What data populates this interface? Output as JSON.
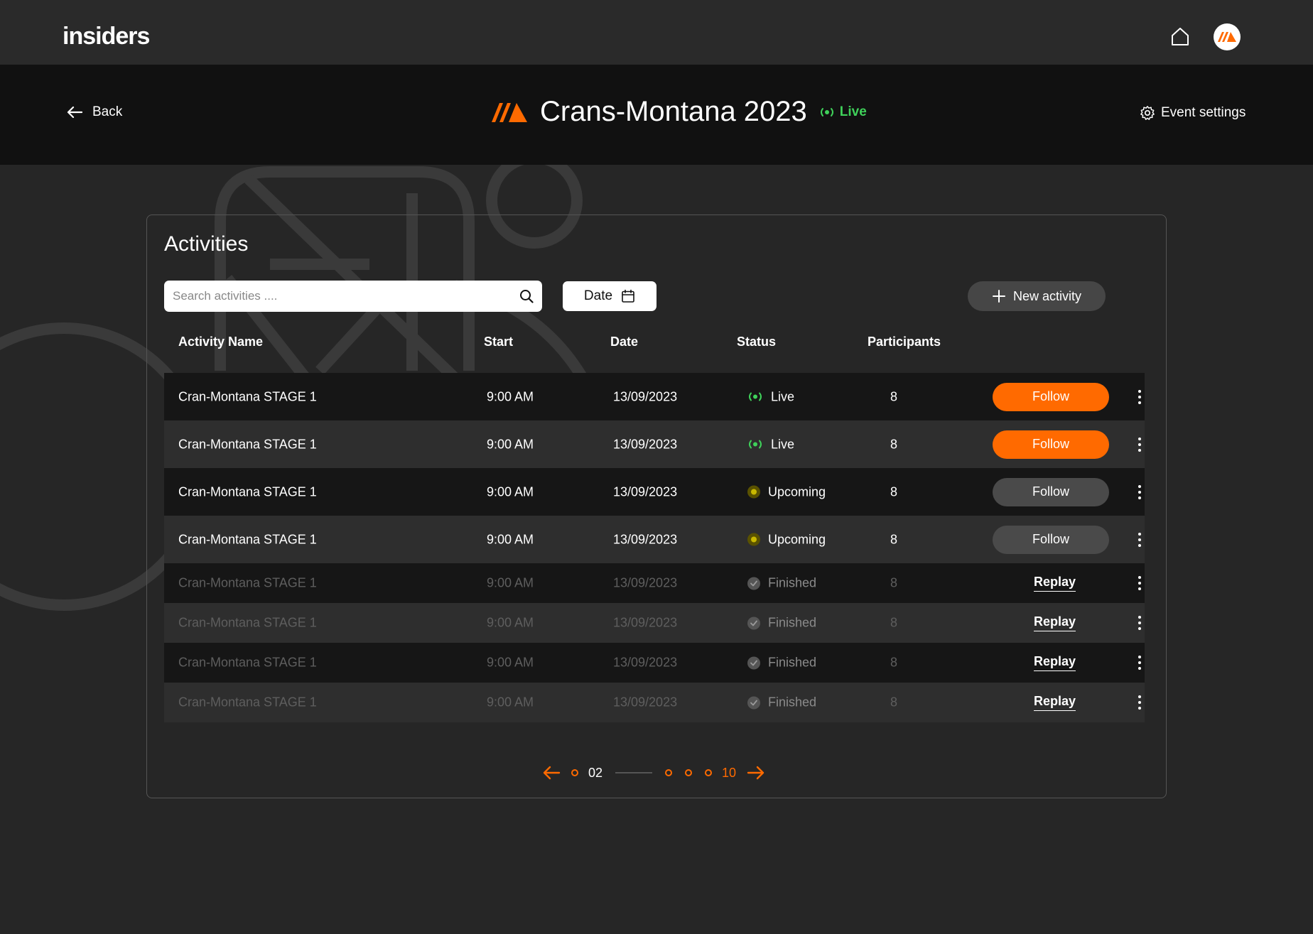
{
  "topbar": {
    "logo_text": "insiders",
    "home_icon": "home-icon",
    "avatar_icon": "brand-stripes-icon"
  },
  "event": {
    "back_label": "Back",
    "title": "Crans-Montana 2023",
    "live_label": "Live",
    "settings_label": "Event settings"
  },
  "activities": {
    "title": "Activities",
    "search_placeholder": "Search activities ....",
    "date_label": "Date",
    "new_activity_label": "New activity",
    "columns": [
      "Activity Name",
      "Start",
      "Date",
      "Status",
      "Participants"
    ],
    "rows": [
      {
        "name": "Cran-Montana STAGE 1",
        "start": "9:00 AM",
        "date": "13/09/2023",
        "status": "Live",
        "participants": "8",
        "action": "Follow"
      },
      {
        "name": "Cran-Montana STAGE 1",
        "start": "9:00 AM",
        "date": "13/09/2023",
        "status": "Live",
        "participants": "8",
        "action": "Follow"
      },
      {
        "name": "Cran-Montana STAGE 1",
        "start": "9:00 AM",
        "date": "13/09/2023",
        "status": "Upcoming",
        "participants": "8",
        "action": "Follow"
      },
      {
        "name": "Cran-Montana STAGE 1",
        "start": "9:00 AM",
        "date": "13/09/2023",
        "status": "Upcoming",
        "participants": "8",
        "action": "Follow"
      },
      {
        "name": "Cran-Montana STAGE 1",
        "start": "9:00 AM",
        "date": "13/09/2023",
        "status": "Finished",
        "participants": "8",
        "action": "Replay"
      },
      {
        "name": "Cran-Montana STAGE 1",
        "start": "9:00 AM",
        "date": "13/09/2023",
        "status": "Finished",
        "participants": "8",
        "action": "Replay"
      },
      {
        "name": "Cran-Montana STAGE 1",
        "start": "9:00 AM",
        "date": "13/09/2023",
        "status": "Finished",
        "participants": "8",
        "action": "Replay"
      },
      {
        "name": "Cran-Montana STAGE 1",
        "start": "9:00 AM",
        "date": "13/09/2023",
        "status": "Finished",
        "participants": "8",
        "action": "Replay"
      }
    ]
  },
  "pagination": {
    "current_page": "02",
    "last_page": "10"
  },
  "colors": {
    "accent": "#ff6a00",
    "live": "#3fd15a",
    "upcoming": "#c9b800",
    "finished": "#777777"
  }
}
